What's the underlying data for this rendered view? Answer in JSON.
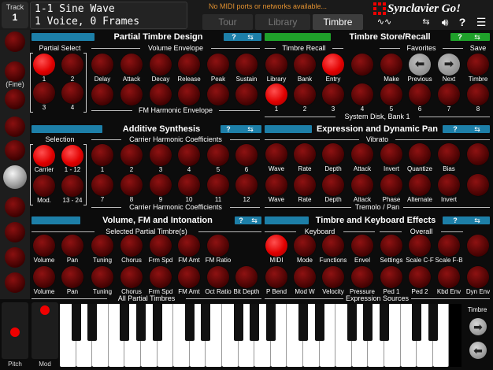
{
  "header": {
    "track_label": "Track",
    "track_number": "1",
    "display_line1": "1-1 Sine Wave",
    "display_line2": "1 Voice, 0 Frames",
    "midi_status": "No MIDI ports or networks available...",
    "tabs": [
      "Tour",
      "Library",
      "Timbre"
    ],
    "active_tab": "Timbre",
    "brand": "Synclavier Go!"
  },
  "sidebar": {
    "fine_label": "(Fine)",
    "pitch_label": "Pitch",
    "mod_label": "Mod"
  },
  "partial_timbre": {
    "title": "Partial Timbre Design",
    "partial_select_label": "Partial Select",
    "partials": [
      "1",
      "2",
      "3",
      "4"
    ],
    "active_partial": "1",
    "volume_envelope_label": "Volume Envelope",
    "volume_envelope": [
      "Delay",
      "Attack",
      "Decay",
      "Release",
      "Peak",
      "Sustain"
    ],
    "fm_envelope_label": "FM Harmonic Envelope"
  },
  "timbre_store": {
    "title": "Timbre Store/Recall",
    "recall_label": "Timbre Recall",
    "recall_buttons": [
      "Library",
      "Bank",
      "Entry"
    ],
    "favorites_label": "Favorites",
    "favorites_buttons": [
      "Make",
      "Previous",
      "Next"
    ],
    "save_label": "Save",
    "save_button": "Timbre",
    "entries": [
      "1",
      "2",
      "3",
      "4",
      "5",
      "6",
      "7",
      "8"
    ],
    "disk_label": "System Disk, Bank 1"
  },
  "additive": {
    "title": "Additive Synthesis",
    "selection_label": "Selection",
    "selection_buttons": [
      "Carrier",
      "1 - 12",
      "Mod.",
      "13 - 24"
    ],
    "carrier_label": "Carrier Harmonic Coefficients",
    "row1": [
      "1",
      "2",
      "3",
      "4",
      "5",
      "6"
    ],
    "row2": [
      "7",
      "8",
      "9",
      "10",
      "11",
      "12"
    ]
  },
  "expression": {
    "title": "Expression and Dynamic Pan",
    "vibrato_label": "Vibrato",
    "vibrato": [
      "Wave",
      "Rate",
      "Depth",
      "Attack",
      "Invert",
      "Quantize",
      "Bias"
    ],
    "tremolo_label": "Tremolo / Pan",
    "tremolo": [
      "Wave",
      "Rate",
      "Depth",
      "Attack",
      "Phase",
      "Alternate",
      "Invert"
    ]
  },
  "volume_fm": {
    "title": "Volume, FM and Intonation",
    "selected_label": "Selected Partial Timbre(s)",
    "row1": [
      "Volume",
      "Pan",
      "Tuning",
      "Chorus",
      "Frm Spd",
      "FM Amt",
      "FM Ratio"
    ],
    "row2": [
      "Volume",
      "Pan",
      "Tuning",
      "Chorus",
      "Frm Spd",
      "FM Amt",
      "Oct Ratio",
      "Bit Depth"
    ],
    "all_label": "All Partial Timbres"
  },
  "keyboard_effects": {
    "title": "Timbre and Keyboard Effects",
    "keyboard_label": "Keyboard",
    "overall_label": "Overall",
    "row1": [
      "MIDI",
      "Mode",
      "Functions",
      "Envel",
      "Settings",
      "Scale C-F",
      "Scale F-B"
    ],
    "row2": [
      "P Bend",
      "Mod W",
      "Velocity",
      "Pressure",
      "Ped 1",
      "Ped 2",
      "Kbd Env",
      "Dyn Env"
    ],
    "sources_label": "Expression Sources"
  },
  "keyboard": {
    "timbre_label": "Timbre"
  },
  "colors": {
    "accent_red": "#e00000",
    "section_blue": "#1d7fa8",
    "store_green": "#1fa02a",
    "warning_orange": "#e09030"
  }
}
